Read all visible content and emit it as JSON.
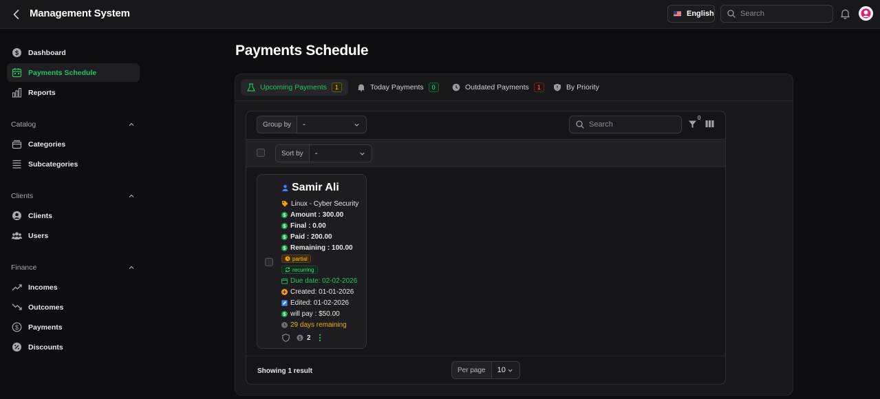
{
  "header": {
    "title": "Management System",
    "language": "English",
    "search_placeholder": "Search"
  },
  "sidebar": {
    "top_items": [
      {
        "label": "Dashboard",
        "icon": "dollar-circle-icon"
      },
      {
        "label": "Payments Schedule",
        "icon": "calendar-icon",
        "active": true
      },
      {
        "label": "Reports",
        "icon": "bar-chart-icon"
      }
    ],
    "groups": [
      {
        "label": "Catalog",
        "items": [
          {
            "label": "Categories",
            "icon": "layers-icon"
          },
          {
            "label": "Subcategories",
            "icon": "list-icon"
          }
        ]
      },
      {
        "label": "Clients",
        "items": [
          {
            "label": "Clients",
            "icon": "user-circle-icon"
          },
          {
            "label": "Users",
            "icon": "users-icon"
          }
        ]
      },
      {
        "label": "Finance",
        "items": [
          {
            "label": "Incomes",
            "icon": "trend-up-icon"
          },
          {
            "label": "Outcomes",
            "icon": "trend-down-icon"
          },
          {
            "label": "Payments",
            "icon": "dollar-icon"
          },
          {
            "label": "Discounts",
            "icon": "discount-icon"
          }
        ]
      }
    ]
  },
  "main": {
    "page_title": "Payments Schedule",
    "tabs": [
      {
        "label": "Upcoming Payments",
        "count": "1",
        "active": true
      },
      {
        "label": "Today Payments",
        "count": "0"
      },
      {
        "label": "Outdated Payments",
        "count": "1"
      },
      {
        "label": "By Priority"
      }
    ],
    "toolbar": {
      "group_by_label": "Group by",
      "group_by_value": "-",
      "search_placeholder": "Search",
      "filter_count": "0",
      "sort_by_label": "Sort by",
      "sort_by_value": "-"
    },
    "card": {
      "name": "Samir Ali",
      "category": "Linux - Cyber Security",
      "amount": "Amount : 300.00",
      "final": "Final : 0.00",
      "paid": "Paid : 200.00",
      "remaining": "Remaining : 100.00",
      "status_badge": "partial",
      "type_badge": "recurring",
      "due_date": "Due date: 02-02-2026",
      "created": "Created: 01-01-2026",
      "edited": "Edited: 01-02-2026",
      "will_pay": "will pay : $50.00",
      "days_remaining": "29 days remaining",
      "installments_count": "2"
    },
    "footer": {
      "showing": "Showing 1 result",
      "per_page_label": "Per page",
      "per_page_value": "10"
    }
  },
  "colors": {
    "accent": "#22c55e",
    "background": "#0d0d0f",
    "panel": "#18181b"
  }
}
